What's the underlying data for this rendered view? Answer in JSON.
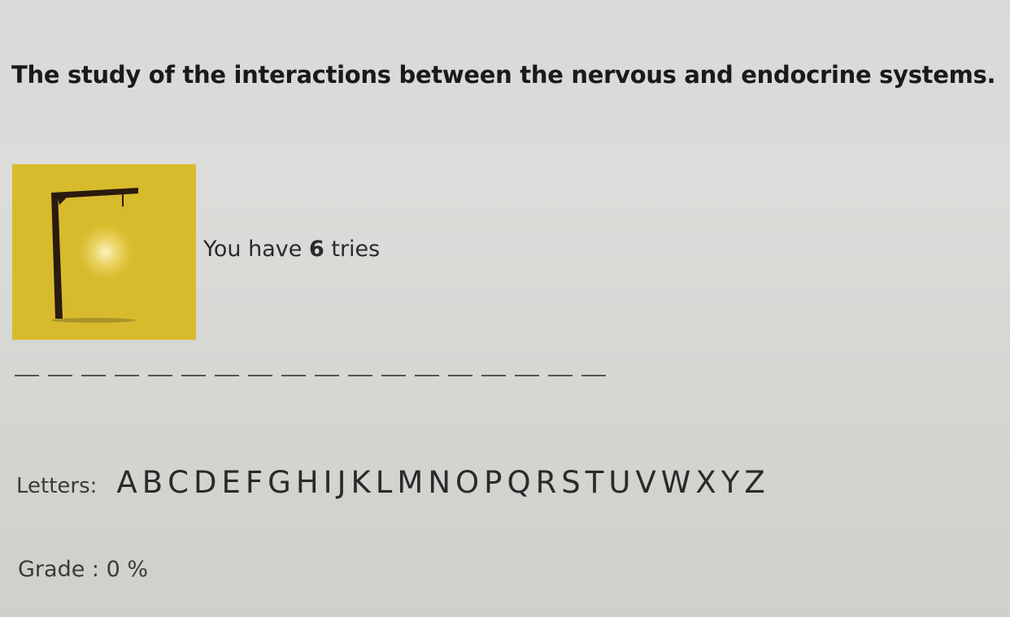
{
  "question": "The study of the interactions between the nervous and endocrine systems.",
  "tries": {
    "prefix": "You have",
    "count": "6",
    "suffix": "tries"
  },
  "blanks": [
    "_",
    "_",
    "_",
    "_",
    "_",
    "_",
    "_",
    "_",
    "_",
    "_",
    "_",
    "_",
    "_",
    "_",
    "_",
    "_",
    "_",
    "_"
  ],
  "letters": {
    "label": "Letters:",
    "items": [
      "A",
      "B",
      "C",
      "D",
      "E",
      "F",
      "G",
      "H",
      "I",
      "J",
      "K",
      "L",
      "M",
      "N",
      "O",
      "P",
      "Q",
      "R",
      "S",
      "T",
      "U",
      "V",
      "W",
      "X",
      "Y",
      "Z"
    ]
  },
  "grade": "Grade : 0 %",
  "colors": {
    "gallows_background": "#d8bb2c",
    "gallows_wood": "#2a1a10",
    "page_background": "#d9d9d7"
  }
}
